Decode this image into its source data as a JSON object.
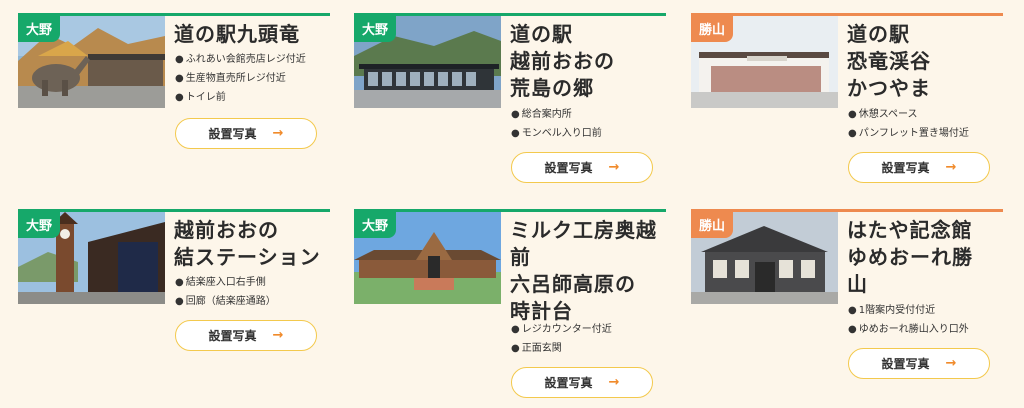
{
  "colors": {
    "ono": "#16a86a",
    "katsuyama": "#ee8a4f",
    "background": "#fdf6ea",
    "button_border": "#f3c94d",
    "arrow": "#f08a2a"
  },
  "cards": [
    {
      "area": "大野",
      "title_lines": [
        "道の駅九頭竜"
      ],
      "bullets": [
        "ふれあい会館売店レジ付近",
        "生産物直売所レジ付近",
        "トイレ前"
      ],
      "button": "設置写真",
      "arrow_icon": "arrow-right-icon"
    },
    {
      "area": "大野",
      "title_lines": [
        "道の駅",
        "越前おおの",
        "荒島の郷"
      ],
      "bullets": [
        "総合案内所",
        "モンベル入り口前"
      ],
      "button": "設置写真",
      "arrow_icon": "arrow-right-icon"
    },
    {
      "area": "勝山",
      "title_lines": [
        "道の駅",
        "恐竜渓谷",
        "かつやま"
      ],
      "bullets": [
        "休憩スペース",
        "パンフレット置き場付近"
      ],
      "button": "設置写真",
      "arrow_icon": "arrow-right-icon"
    },
    {
      "area": "大野",
      "title_lines": [
        "越前おおの",
        "結ステーション"
      ],
      "bullets": [
        "結楽座入口右手側",
        "回廊（結楽座通路）"
      ],
      "button": "設置写真",
      "arrow_icon": "arrow-right-icon"
    },
    {
      "area": "大野",
      "title_lines": [
        "ミルク工房奥越",
        "前",
        "六呂師高原の",
        "時計台"
      ],
      "bullets": [
        "レジカウンター付近",
        "正面玄関"
      ],
      "button": "設置写真",
      "arrow_icon": "arrow-right-icon"
    },
    {
      "area": "勝山",
      "title_lines": [
        "はたや記念館",
        "ゆめおーれ勝",
        "山"
      ],
      "bullets": [
        "1階案内受付付近",
        "ゆめおーれ勝山入り口外"
      ],
      "button": "設置写真",
      "arrow_icon": "arrow-right-icon"
    }
  ]
}
